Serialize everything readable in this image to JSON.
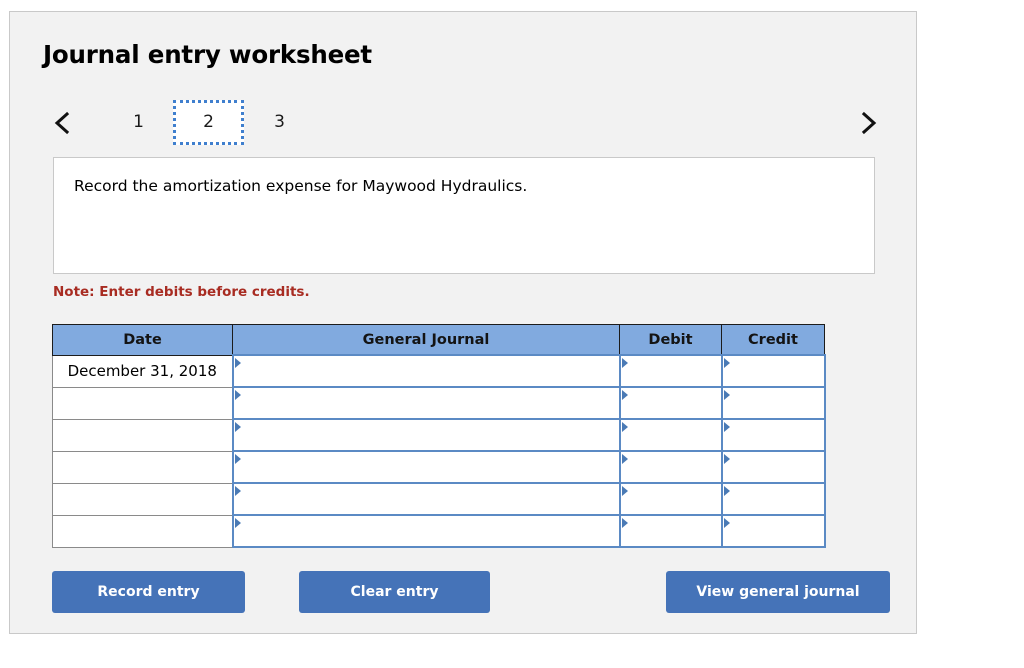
{
  "worksheet": {
    "title": "Journal entry worksheet",
    "pager": {
      "prev_icon": "chevron-left-icon",
      "next_icon": "chevron-right-icon",
      "tabs": [
        {
          "label": "1",
          "selected": false
        },
        {
          "label": "2",
          "selected": true
        },
        {
          "label": "3",
          "selected": false
        }
      ]
    },
    "description": "Record the amortization expense for Maywood Hydraulics.",
    "note": "Note: Enter debits before credits.",
    "table": {
      "headers": [
        "Date",
        "General Journal",
        "Debit",
        "Credit"
      ],
      "rows": [
        {
          "date": "December 31, 2018",
          "general_journal": "",
          "debit": "",
          "credit": ""
        },
        {
          "date": "",
          "general_journal": "",
          "debit": "",
          "credit": ""
        },
        {
          "date": "",
          "general_journal": "",
          "debit": "",
          "credit": ""
        },
        {
          "date": "",
          "general_journal": "",
          "debit": "",
          "credit": ""
        },
        {
          "date": "",
          "general_journal": "",
          "debit": "",
          "credit": ""
        },
        {
          "date": "",
          "general_journal": "",
          "debit": "",
          "credit": ""
        }
      ]
    },
    "buttons": {
      "record": "Record entry",
      "clear": "Clear entry",
      "view": "View general journal"
    },
    "colors": {
      "header_blue": "#81aadf",
      "button_blue": "#4573b8",
      "note_red": "#a82c22",
      "selected_tab_border": "#3f7fce",
      "cell_border_blue": "#5b8ac4",
      "card_bg": "#f2f2f2"
    }
  }
}
